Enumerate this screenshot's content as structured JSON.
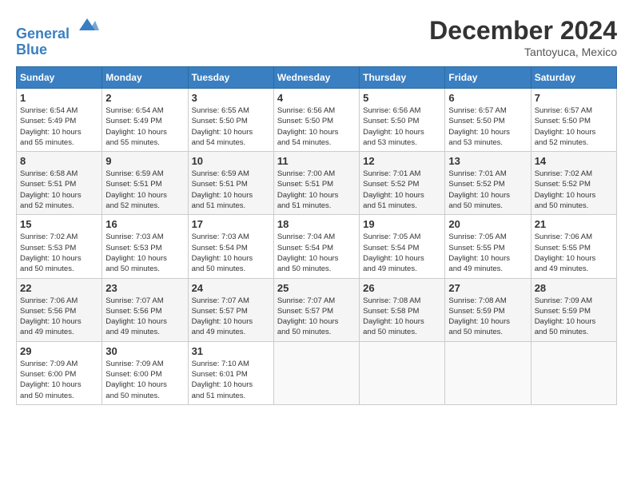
{
  "header": {
    "logo_line1": "General",
    "logo_line2": "Blue",
    "month": "December 2024",
    "location": "Tantoyuca, Mexico"
  },
  "weekdays": [
    "Sunday",
    "Monday",
    "Tuesday",
    "Wednesday",
    "Thursday",
    "Friday",
    "Saturday"
  ],
  "weeks": [
    [
      {
        "day": 1,
        "info": "Sunrise: 6:54 AM\nSunset: 5:49 PM\nDaylight: 10 hours\nand 55 minutes."
      },
      {
        "day": 2,
        "info": "Sunrise: 6:54 AM\nSunset: 5:49 PM\nDaylight: 10 hours\nand 55 minutes."
      },
      {
        "day": 3,
        "info": "Sunrise: 6:55 AM\nSunset: 5:50 PM\nDaylight: 10 hours\nand 54 minutes."
      },
      {
        "day": 4,
        "info": "Sunrise: 6:56 AM\nSunset: 5:50 PM\nDaylight: 10 hours\nand 54 minutes."
      },
      {
        "day": 5,
        "info": "Sunrise: 6:56 AM\nSunset: 5:50 PM\nDaylight: 10 hours\nand 53 minutes."
      },
      {
        "day": 6,
        "info": "Sunrise: 6:57 AM\nSunset: 5:50 PM\nDaylight: 10 hours\nand 53 minutes."
      },
      {
        "day": 7,
        "info": "Sunrise: 6:57 AM\nSunset: 5:50 PM\nDaylight: 10 hours\nand 52 minutes."
      }
    ],
    [
      {
        "day": 8,
        "info": "Sunrise: 6:58 AM\nSunset: 5:51 PM\nDaylight: 10 hours\nand 52 minutes."
      },
      {
        "day": 9,
        "info": "Sunrise: 6:59 AM\nSunset: 5:51 PM\nDaylight: 10 hours\nand 52 minutes."
      },
      {
        "day": 10,
        "info": "Sunrise: 6:59 AM\nSunset: 5:51 PM\nDaylight: 10 hours\nand 51 minutes."
      },
      {
        "day": 11,
        "info": "Sunrise: 7:00 AM\nSunset: 5:51 PM\nDaylight: 10 hours\nand 51 minutes."
      },
      {
        "day": 12,
        "info": "Sunrise: 7:01 AM\nSunset: 5:52 PM\nDaylight: 10 hours\nand 51 minutes."
      },
      {
        "day": 13,
        "info": "Sunrise: 7:01 AM\nSunset: 5:52 PM\nDaylight: 10 hours\nand 50 minutes."
      },
      {
        "day": 14,
        "info": "Sunrise: 7:02 AM\nSunset: 5:52 PM\nDaylight: 10 hours\nand 50 minutes."
      }
    ],
    [
      {
        "day": 15,
        "info": "Sunrise: 7:02 AM\nSunset: 5:53 PM\nDaylight: 10 hours\nand 50 minutes."
      },
      {
        "day": 16,
        "info": "Sunrise: 7:03 AM\nSunset: 5:53 PM\nDaylight: 10 hours\nand 50 minutes."
      },
      {
        "day": 17,
        "info": "Sunrise: 7:03 AM\nSunset: 5:54 PM\nDaylight: 10 hours\nand 50 minutes."
      },
      {
        "day": 18,
        "info": "Sunrise: 7:04 AM\nSunset: 5:54 PM\nDaylight: 10 hours\nand 50 minutes."
      },
      {
        "day": 19,
        "info": "Sunrise: 7:05 AM\nSunset: 5:54 PM\nDaylight: 10 hours\nand 49 minutes."
      },
      {
        "day": 20,
        "info": "Sunrise: 7:05 AM\nSunset: 5:55 PM\nDaylight: 10 hours\nand 49 minutes."
      },
      {
        "day": 21,
        "info": "Sunrise: 7:06 AM\nSunset: 5:55 PM\nDaylight: 10 hours\nand 49 minutes."
      }
    ],
    [
      {
        "day": 22,
        "info": "Sunrise: 7:06 AM\nSunset: 5:56 PM\nDaylight: 10 hours\nand 49 minutes."
      },
      {
        "day": 23,
        "info": "Sunrise: 7:07 AM\nSunset: 5:56 PM\nDaylight: 10 hours\nand 49 minutes."
      },
      {
        "day": 24,
        "info": "Sunrise: 7:07 AM\nSunset: 5:57 PM\nDaylight: 10 hours\nand 49 minutes."
      },
      {
        "day": 25,
        "info": "Sunrise: 7:07 AM\nSunset: 5:57 PM\nDaylight: 10 hours\nand 50 minutes."
      },
      {
        "day": 26,
        "info": "Sunrise: 7:08 AM\nSunset: 5:58 PM\nDaylight: 10 hours\nand 50 minutes."
      },
      {
        "day": 27,
        "info": "Sunrise: 7:08 AM\nSunset: 5:59 PM\nDaylight: 10 hours\nand 50 minutes."
      },
      {
        "day": 28,
        "info": "Sunrise: 7:09 AM\nSunset: 5:59 PM\nDaylight: 10 hours\nand 50 minutes."
      }
    ],
    [
      {
        "day": 29,
        "info": "Sunrise: 7:09 AM\nSunset: 6:00 PM\nDaylight: 10 hours\nand 50 minutes."
      },
      {
        "day": 30,
        "info": "Sunrise: 7:09 AM\nSunset: 6:00 PM\nDaylight: 10 hours\nand 50 minutes."
      },
      {
        "day": 31,
        "info": "Sunrise: 7:10 AM\nSunset: 6:01 PM\nDaylight: 10 hours\nand 51 minutes."
      },
      null,
      null,
      null,
      null
    ]
  ]
}
